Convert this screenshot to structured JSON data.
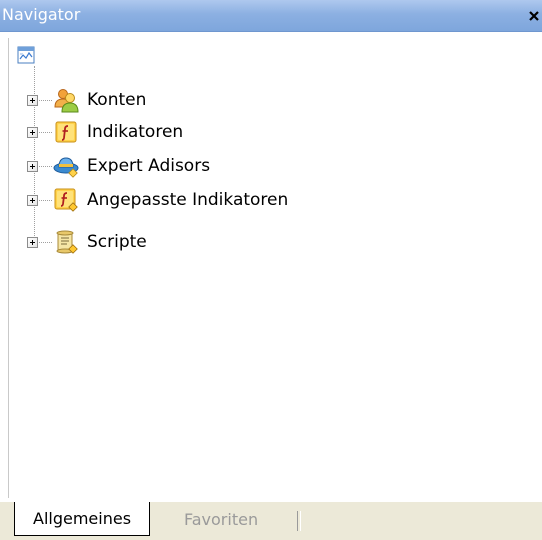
{
  "window": {
    "title": "Navigator",
    "close_glyph": "×"
  },
  "tree": {
    "root_icon": "navigator-root-icon",
    "items": [
      {
        "label": "Konten",
        "icon": "accounts-icon"
      },
      {
        "label": "Indikatoren",
        "icon": "indicator-function-icon"
      },
      {
        "label": "Expert Adisors",
        "icon": "expert-advisor-hat-icon"
      },
      {
        "label": "Angepasste Indikatoren",
        "icon": "custom-indicator-icon"
      },
      {
        "label": "Scripte",
        "icon": "script-scroll-icon"
      }
    ]
  },
  "tabs": [
    {
      "label": "Allgemeines",
      "active": true
    },
    {
      "label": "Favoriten",
      "active": false
    }
  ],
  "colors": {
    "titlebar": "#8cb0e2",
    "title_text": "#ffffff",
    "tab_inactive_text": "#9a9a9a",
    "tabbar_bg": "#ece9d8"
  }
}
